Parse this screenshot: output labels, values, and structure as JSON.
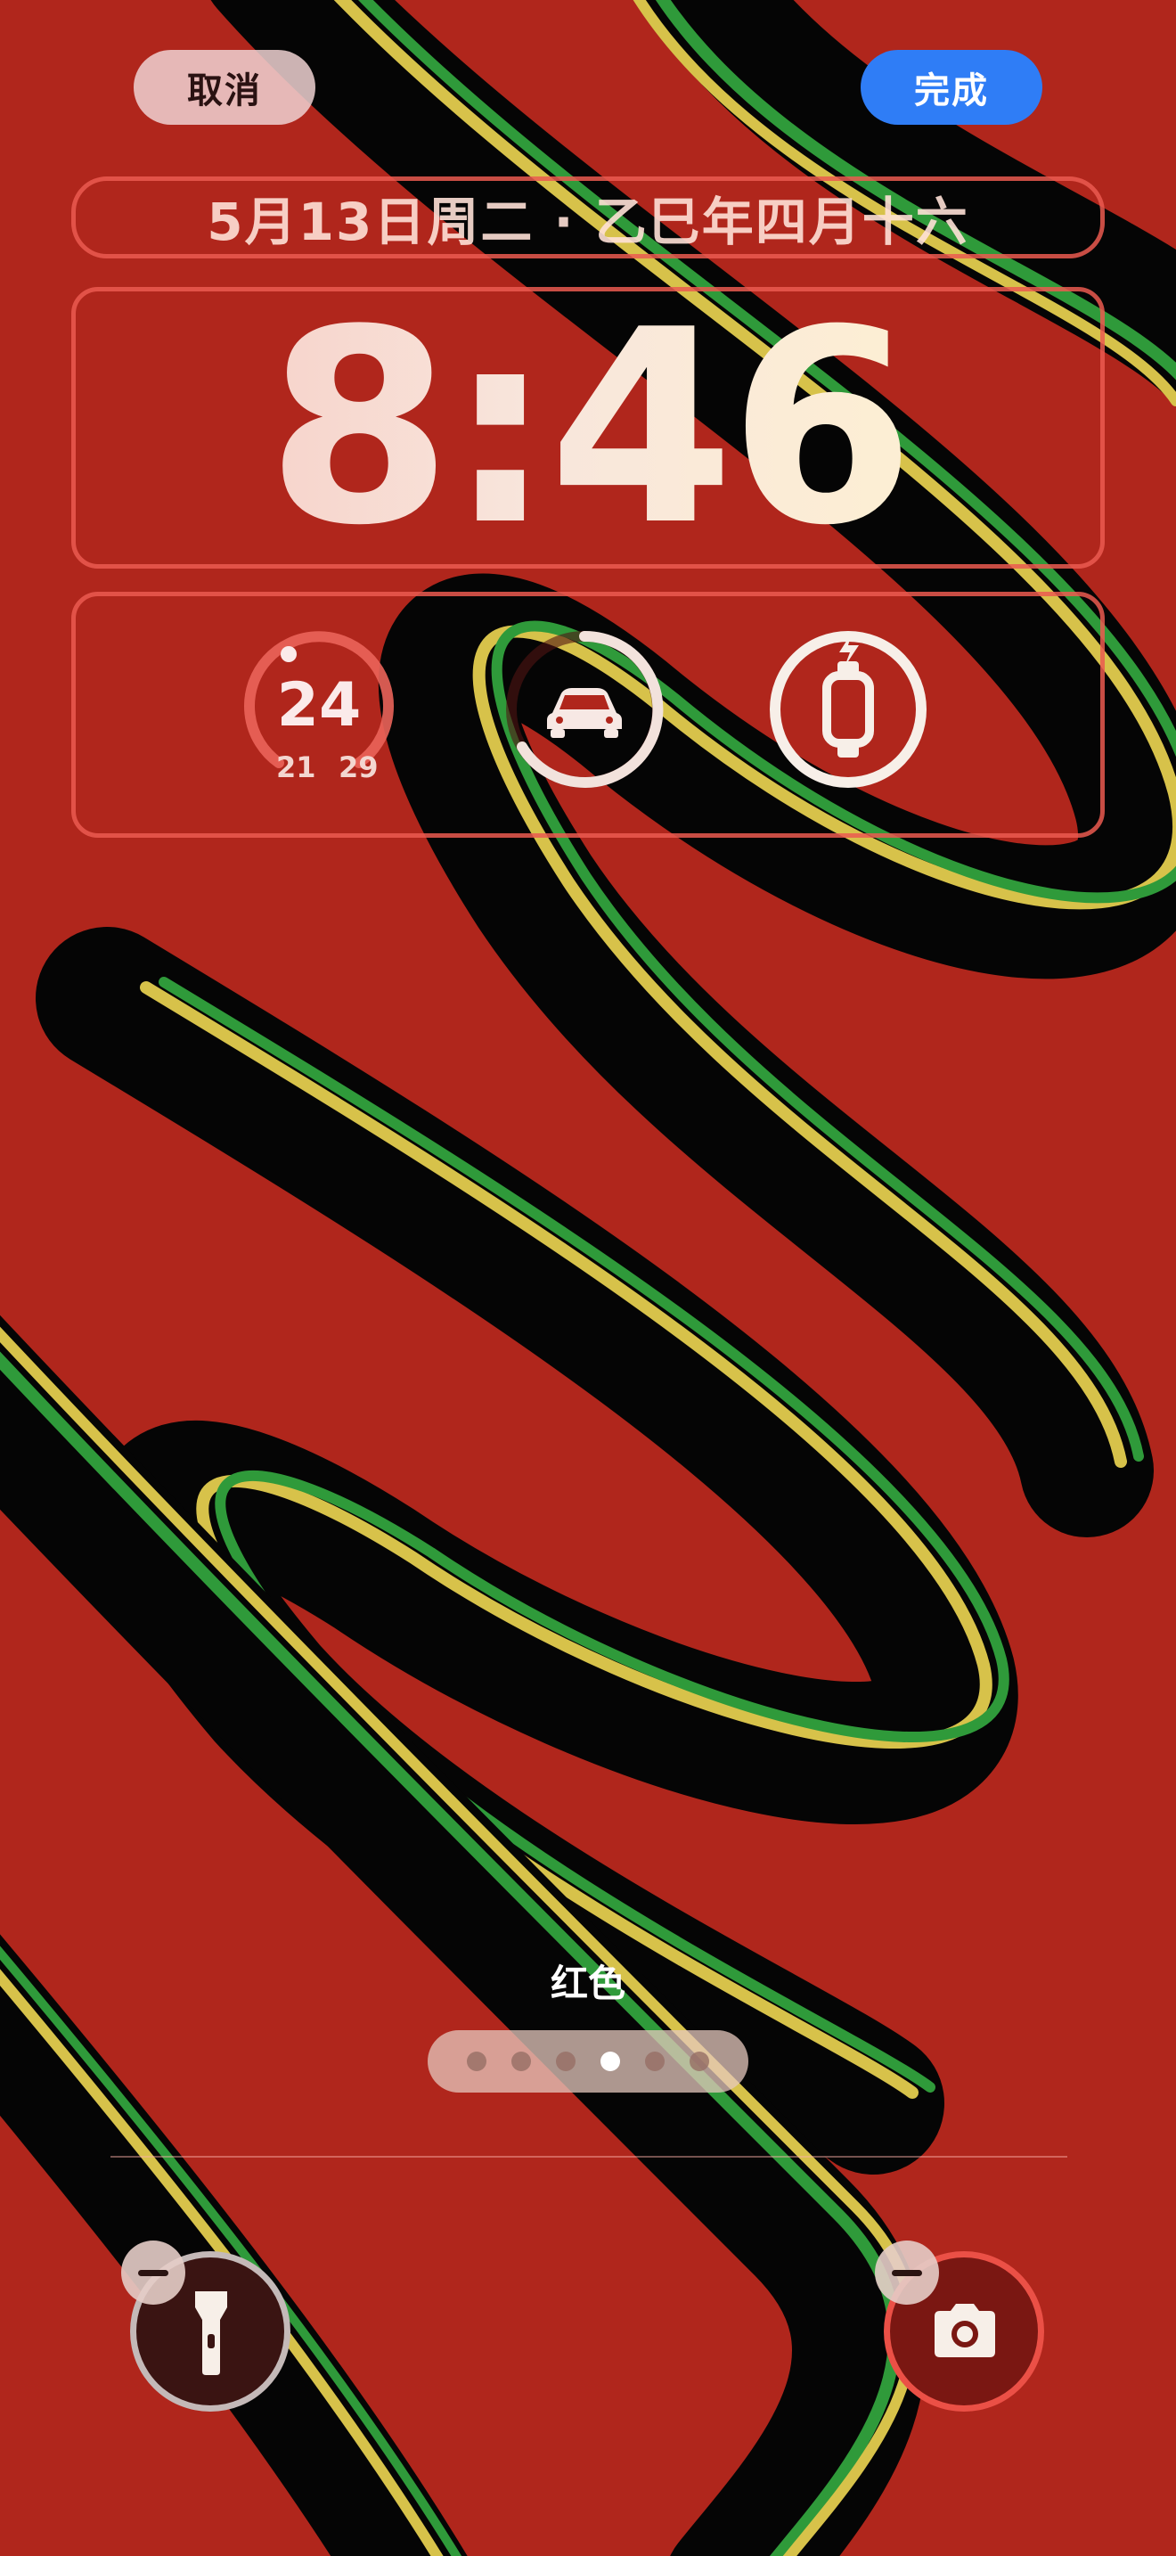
{
  "toolbar": {
    "cancel_label": "取消",
    "done_label": "完成"
  },
  "lockscreen": {
    "date_line": "5月13日周二 · 乙巳年四月十六",
    "time": "8:46"
  },
  "widgets": {
    "weather": {
      "temp": "24",
      "low": "21",
      "high": "29",
      "icon": "weather-gauge"
    },
    "car": {
      "icon": "car-icon",
      "level": 0.8
    },
    "watch": {
      "icon": "watch-charging-icon",
      "level": 1.0
    }
  },
  "wallpaper": {
    "name": "红色",
    "page_count": 6,
    "active_page": 4,
    "colors": {
      "background": "#b0261c",
      "black": "#050505",
      "green": "#2f9a3a",
      "yellow": "#d7c24a"
    }
  },
  "quick_actions": [
    {
      "name": "flashlight",
      "icon": "flashlight-icon"
    },
    {
      "name": "camera",
      "icon": "camera-icon"
    }
  ],
  "accent": {
    "done": "#2f7df6",
    "edit_outline": "#eb5a50"
  }
}
